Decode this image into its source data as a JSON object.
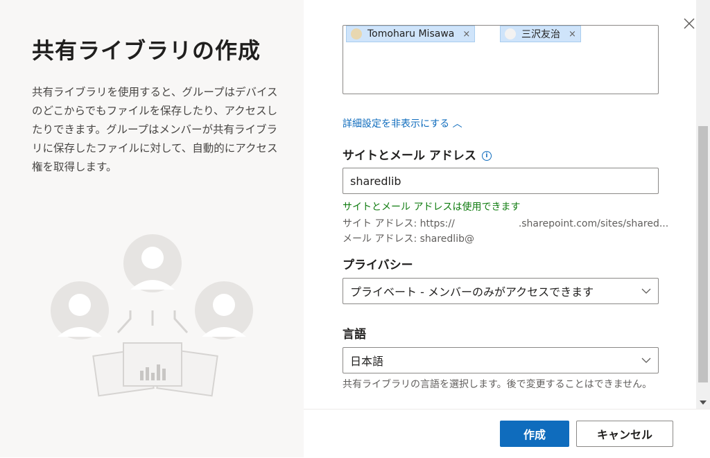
{
  "left": {
    "title": "共有ライブラリの作成",
    "description": "共有ライブラリを使用すると、グループはデバイスのどこからでもファイルを保存したり、アクセスしたりできます。グループはメンバーが共有ライブラリに保存したファイルに対して、自動的にアクセス権を取得します。"
  },
  "recipients": [
    {
      "name": "Tomoharu Misawa",
      "remove": "×"
    },
    {
      "name": "三沢友治",
      "remove": "×"
    }
  ],
  "advanced_toggle": "詳細設定を非表示にする ︿",
  "site": {
    "label": "サイトとメール アドレス",
    "info_icon": "i",
    "value": "sharedlib",
    "status": "サイトとメール アドレスは使用できます",
    "site_address_prefix": "サイト アドレス: https://",
    "site_address_suffix": ".sharepoint.com/sites/shared...",
    "mail_address": "メール アドレス: sharedlib@"
  },
  "privacy": {
    "label": "プライバシー",
    "selected": "プライベート - メンバーのみがアクセスできます"
  },
  "language": {
    "label": "言語",
    "selected": "日本語",
    "help": "共有ライブラリの言語を選択します。後で変更することはできません。"
  },
  "buttons": {
    "create": "作成",
    "cancel": "キャンセル"
  },
  "colors": {
    "accent": "#0f6cbd",
    "success": "#107c10",
    "left_panel_bg": "#f8f7f6"
  }
}
